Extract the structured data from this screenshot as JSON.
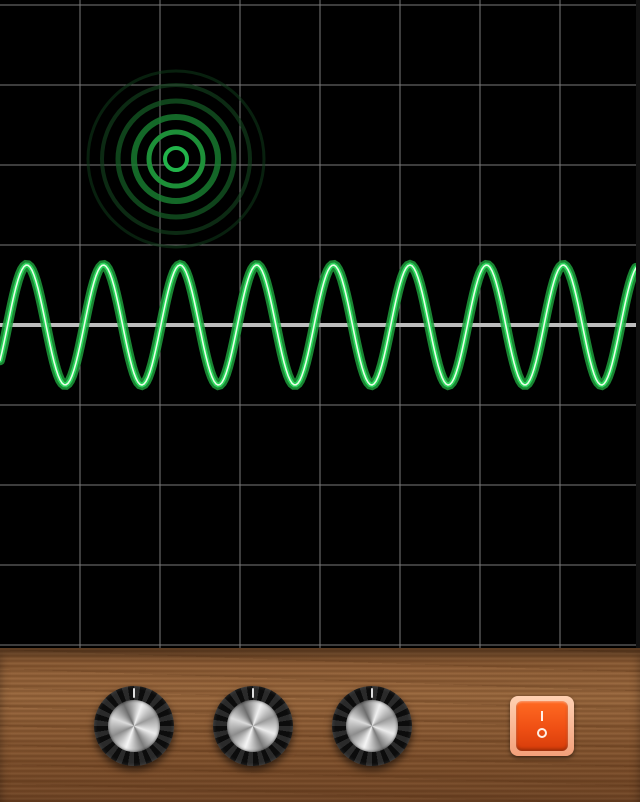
{
  "app": {
    "name": "",
    "colors": {
      "background": "#000000",
      "grid": "#7a7a7a",
      "waveform": "#22c14b",
      "waveform_core": "#d9ffd9",
      "baseline": "#bdbdbd",
      "cursor": "#1fae45",
      "switch": "#ef5418",
      "wood": "#8f5e36"
    }
  },
  "scope": {
    "grid": "on",
    "grid_divisions": {
      "columns": 8,
      "rows": 8
    },
    "waveform": {
      "shape": "sine",
      "cycles_visible": 8.3,
      "amplitude_divisions": 0.75
    },
    "cursor": {
      "icon": "target-icon"
    }
  },
  "controls": {
    "knobs": [
      {
        "name": "knob-1",
        "icon": "rotary-knob"
      },
      {
        "name": "knob-2",
        "icon": "rotary-knob"
      },
      {
        "name": "knob-3",
        "icon": "rotary-knob"
      }
    ],
    "power_switch": {
      "on_symbol": "I",
      "off_symbol": "O",
      "state": "on"
    }
  }
}
